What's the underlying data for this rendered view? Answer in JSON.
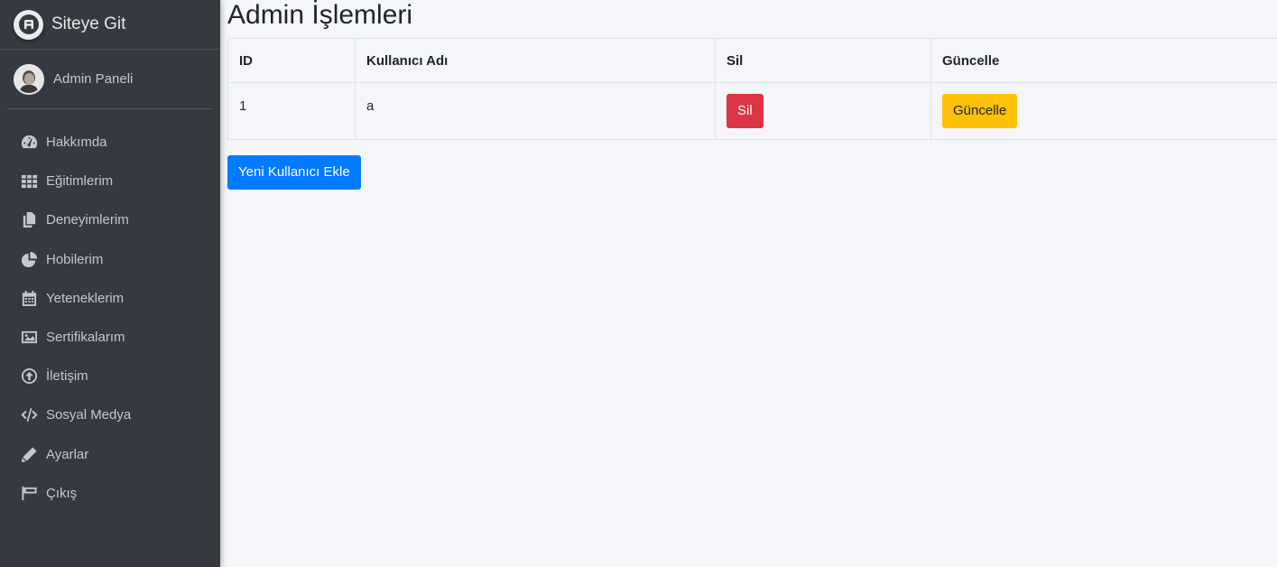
{
  "brand": {
    "title": "Siteye Git"
  },
  "user": {
    "name": "Admin Paneli"
  },
  "sidebar": {
    "items": [
      {
        "label": "Hakkımda",
        "icon": "tachometer-icon"
      },
      {
        "label": "Eğitimlerim",
        "icon": "grid-icon"
      },
      {
        "label": "Deneyimlerim",
        "icon": "copy-icon"
      },
      {
        "label": "Hobilerim",
        "icon": "pie-chart-icon"
      },
      {
        "label": "Yeteneklerim",
        "icon": "calendar-icon"
      },
      {
        "label": "Sertifikalarım",
        "icon": "image-icon"
      },
      {
        "label": "İletişim",
        "icon": "arrow-circle-up-icon"
      },
      {
        "label": "Sosyal Medya",
        "icon": "code-icon"
      },
      {
        "label": "Ayarlar",
        "icon": "pencil-icon"
      },
      {
        "label": "Çıkış",
        "icon": "flag-icon"
      }
    ]
  },
  "main": {
    "title": "Admin İşlemleri",
    "table": {
      "headers": [
        "ID",
        "Kullanıcı Adı",
        "Sil",
        "Güncelle"
      ],
      "rows": [
        {
          "id": "1",
          "username": "a",
          "delete_label": "Sil",
          "update_label": "Güncelle"
        }
      ]
    },
    "add_button": "Yeni Kullanıcı Ekle"
  },
  "colors": {
    "sidebar_bg": "#343a40",
    "content_bg": "#f4f6f9",
    "danger": "#dc3545",
    "warning": "#ffc107",
    "primary": "#007bff"
  }
}
